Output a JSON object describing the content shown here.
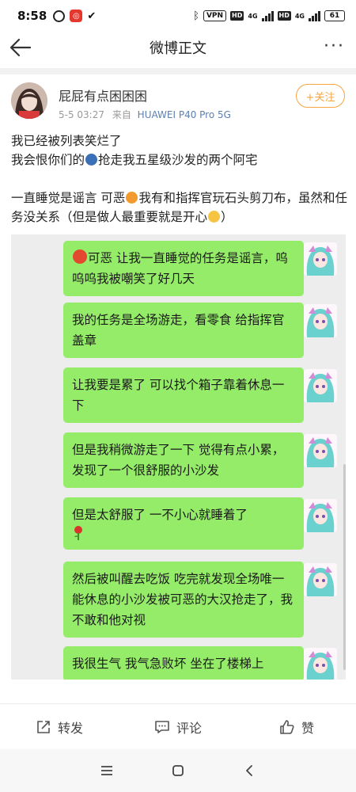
{
  "status_bar": {
    "time": "8:58",
    "vpn": "VPN",
    "hd1": "HD",
    "net1": "4G",
    "hd2": "HD",
    "net2": "4G",
    "battery": "61"
  },
  "header": {
    "title": "微博正文"
  },
  "author": {
    "name": "屁屁有点困困困",
    "time": "5-5 03:27",
    "source_prefix": "来自",
    "device": "HUAWEI P40 Pro 5G",
    "follow_label": "+关注"
  },
  "post": {
    "line1": "我已经被列表笑烂了",
    "line2_a": "我会恨你们的",
    "line2_b": "抢走我五星级沙发的两个阿宅",
    "line3_a": "一直睡觉是谣言 可恶",
    "line3_b": "我有和指挥官玩石头剪刀布，虽然和任务没关系（但是做人最重要就是开心",
    "line3_c": "）"
  },
  "chat": {
    "messages": [
      {
        "text": "可恶 让我一直睡觉的任务是谣言，呜呜呜我被嘲笑了好几天"
      },
      {
        "text": "我的任务是全场游走，看零食 给指挥官盖章"
      },
      {
        "text": "让我要是累了 可以找个箱子靠着休息一下"
      },
      {
        "text": "但是我稍微游走了一下 觉得有点小累，发现了一个很舒服的小沙发"
      },
      {
        "text": "但是太舒服了 一不小心就睡着了"
      },
      {
        "text": "然后被叫醒去吃饭 吃完就发现全场唯一能休息的小沙发被可恶的大汉抢走了，我不敢和他对视"
      },
      {
        "text": "我很生气 我气急败坏 坐在了楼梯上"
      }
    ]
  },
  "actions": {
    "repost": "转发",
    "comment": "评论",
    "like": "赞"
  },
  "colors": {
    "bubble": "#95ec69",
    "follow": "#f7a540",
    "device_link": "#5d7fb0"
  }
}
